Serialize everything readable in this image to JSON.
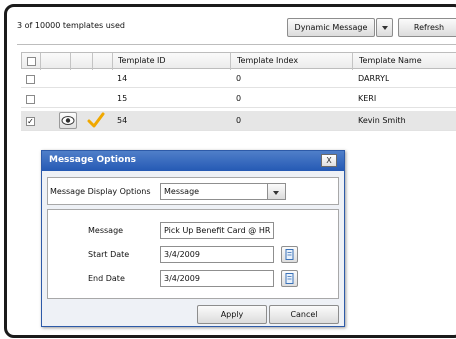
{
  "toolbar": {
    "usage_text": "3 of 10000 templates used",
    "dynamic_message_label": "Dynamic Message",
    "refresh_label": "Refresh"
  },
  "grid": {
    "columns": [
      "Template ID",
      "Template Index",
      "Template Name"
    ],
    "rows": [
      {
        "id": "14",
        "index": "0",
        "name": "DARRYL",
        "checked": false
      },
      {
        "id": "15",
        "index": "0",
        "name": "KERI",
        "checked": false
      },
      {
        "id": "54",
        "index": "0",
        "name": "Kevin  Smith",
        "checked": true
      }
    ],
    "row_icons": [
      "eye-icon",
      "checkmark-icon"
    ]
  },
  "dialog": {
    "title": "Message Options",
    "close_label": "X",
    "display_options_label": "Message Display Options",
    "display_option_selected": "Message",
    "message_label": "Message",
    "message_value": "Pick Up Benefit Card @ HR",
    "start_date_label": "Start Date",
    "start_date_value": "3/4/2009",
    "end_date_label": "End Date",
    "end_date_value": "3/4/2009",
    "apply_label": "Apply",
    "cancel_label": "Cancel"
  },
  "colors": {
    "titlebar": "#2559b4",
    "selected_row": "#e6e6e6",
    "checkmark": "#f0a800"
  }
}
